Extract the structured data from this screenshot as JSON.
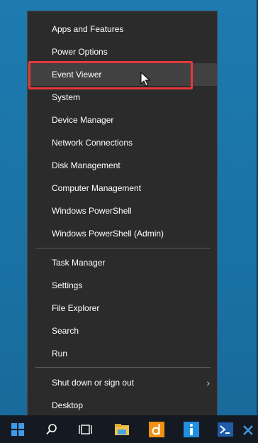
{
  "menu": {
    "group1": [
      {
        "label": "Apps and Features"
      },
      {
        "label": "Power Options"
      },
      {
        "label": "Event Viewer"
      },
      {
        "label": "System"
      },
      {
        "label": "Device Manager"
      },
      {
        "label": "Network Connections"
      },
      {
        "label": "Disk Management"
      },
      {
        "label": "Computer Management"
      },
      {
        "label": "Windows PowerShell"
      },
      {
        "label": "Windows PowerShell (Admin)"
      }
    ],
    "group2": [
      {
        "label": "Task Manager"
      },
      {
        "label": "Settings"
      },
      {
        "label": "File Explorer"
      },
      {
        "label": "Search"
      },
      {
        "label": "Run"
      }
    ],
    "group3": [
      {
        "label": "Shut down or sign out",
        "submenu": true
      },
      {
        "label": "Desktop"
      }
    ],
    "highlighted_item": "Event Viewer",
    "submenu_arrow": "›"
  },
  "taskbar": {
    "icons": [
      "windows-start-icon",
      "search-icon",
      "task-view-icon",
      "file-explorer-icon",
      "orange-app-icon",
      "info-app-icon",
      "powershell-icon",
      "close-icon"
    ]
  },
  "colors": {
    "desktop": "#1a73a6",
    "menu_bg": "#2b2b2b",
    "hover_bg": "#414141",
    "highlight_border": "#e5393b",
    "taskbar": "#151a22"
  }
}
